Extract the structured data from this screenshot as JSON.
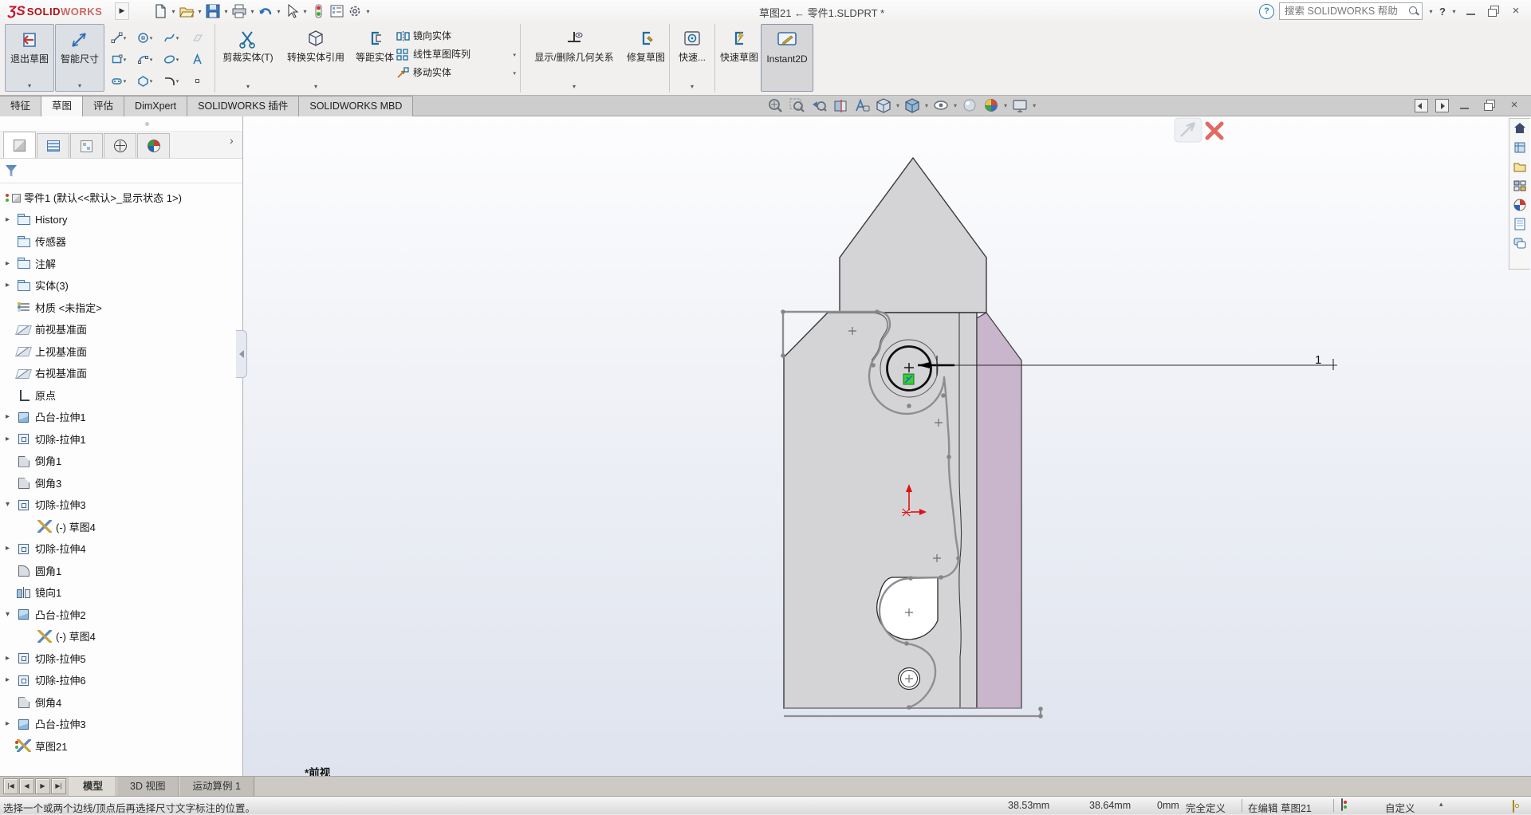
{
  "ui": {
    "caret": "▾",
    "chevron": "›",
    "flyout_arrow": "▶",
    "close_glyph": "×",
    "min_glyph": "",
    "help_glyph": "?"
  },
  "titlebar": {
    "logo_ds": "ƷS",
    "logo_solid": "SOLID",
    "logo_works": "WORKS",
    "title": "草图21 ← 零件1.SLDPRT *",
    "help": "?",
    "search_placeholder": "搜索 SOLIDWORKS 帮助",
    "toolbar_icons": [
      "new-document",
      "open",
      "save",
      "print",
      "undo",
      "select",
      "options-traffic",
      "file-properties",
      "settings-gear"
    ]
  },
  "ribbon": {
    "exit_sketch": "退出草图",
    "smart_dimension": "智能尺寸",
    "trim_entities": "剪裁实体(T)",
    "convert_entities": "转换实体引用",
    "offset_entities": "等距实体",
    "mirror_entities": "镜向实体",
    "linear_sketch_pattern": "线性草图阵列",
    "move_entities": "移动实体",
    "display_delete_relations": "显示/删除几何关系",
    "repair_sketch": "修复草图",
    "quick_snaps": "快速...",
    "rapid_sketch": "快速草图",
    "instant2d": "Instant2D",
    "sketch_tools": [
      "line",
      "circle",
      "spline",
      "sketch-plane",
      "corner-rectangle",
      "arc",
      "ellipse",
      "text",
      "slot",
      "polygon",
      "sketch-fillet",
      "point"
    ]
  },
  "command_tabs": {
    "items": [
      "特征",
      "草图",
      "评估",
      "DimXpert",
      "SOLIDWORKS 插件",
      "SOLIDWORKS MBD"
    ],
    "active": "草图"
  },
  "headsup_icons": [
    "zoom-to-fit",
    "zoom-to-area",
    "previous-view",
    "section-view",
    "dynamic-annotation-views",
    "view-orientation",
    "display-style",
    "hide-show-items",
    "edit-appearance",
    "apply-scene",
    "view-settings"
  ],
  "tree": {
    "filter_icon": "filter-funnel",
    "items": [
      {
        "arrow": "",
        "label": "零件1 (默认<<默认>_显示状态 1>)"
      },
      {
        "arrow": "▸",
        "label": "History"
      },
      {
        "arrow": "",
        "label": "传感器"
      },
      {
        "arrow": "▸",
        "label": "注解"
      },
      {
        "arrow": "▸",
        "label": "实体(3)"
      },
      {
        "arrow": "",
        "label": "材质 <未指定>"
      },
      {
        "arrow": "",
        "label": "前视基准面"
      },
      {
        "arrow": "",
        "label": "上视基准面"
      },
      {
        "arrow": "",
        "label": "右视基准面"
      },
      {
        "arrow": "",
        "label": "原点"
      },
      {
        "arrow": "▸",
        "label": "凸台-拉伸1"
      },
      {
        "arrow": "▸",
        "label": "切除-拉伸1"
      },
      {
        "arrow": "",
        "label": "倒角1"
      },
      {
        "arrow": "",
        "label": "倒角3"
      },
      {
        "arrow": "▾",
        "label": "切除-拉伸3"
      },
      {
        "arrow": "",
        "label": "(-) 草图4"
      },
      {
        "arrow": "▸",
        "label": "切除-拉伸4"
      },
      {
        "arrow": "",
        "label": "圆角1"
      },
      {
        "arrow": "",
        "label": "镜向1"
      },
      {
        "arrow": "▾",
        "label": "凸台-拉伸2"
      },
      {
        "arrow": "",
        "label": "(-) 草图4"
      },
      {
        "arrow": "▸",
        "label": "切除-拉伸5"
      },
      {
        "arrow": "▸",
        "label": "切除-拉伸6"
      },
      {
        "arrow": "",
        "label": "倒角4"
      },
      {
        "arrow": "▸",
        "label": "凸台-拉伸3"
      },
      {
        "arrow": "",
        "label": "草图21"
      }
    ]
  },
  "viewport": {
    "view_label": "*前视",
    "dimension_label": "1",
    "colors": {
      "part_gray": "#d4d4d6",
      "side_face_purple": "#c9b5cc",
      "sketch_gray": "#8e8e92",
      "origin_red": "#e01111",
      "relation_green": "#37cf37"
    }
  },
  "taskpane_icons": [
    "solidworks-resources",
    "design-library",
    "file-explorer",
    "view-palette",
    "appearances-scenes",
    "custom-properties",
    "solidworks-forum"
  ],
  "doc_tabs": {
    "items": [
      "模型",
      "3D 视图",
      "运动算例 1"
    ],
    "active": "模型"
  },
  "statusbar": {
    "message": "选择一个或两个边线/顶点后再选择尺寸文字标注的位置。",
    "x": "38.53mm",
    "y": "38.64mm",
    "z": "0mm",
    "definition": "完全定义",
    "editing": "在编辑 草图21",
    "custom": "自定义",
    "custom_caret": "▴"
  }
}
